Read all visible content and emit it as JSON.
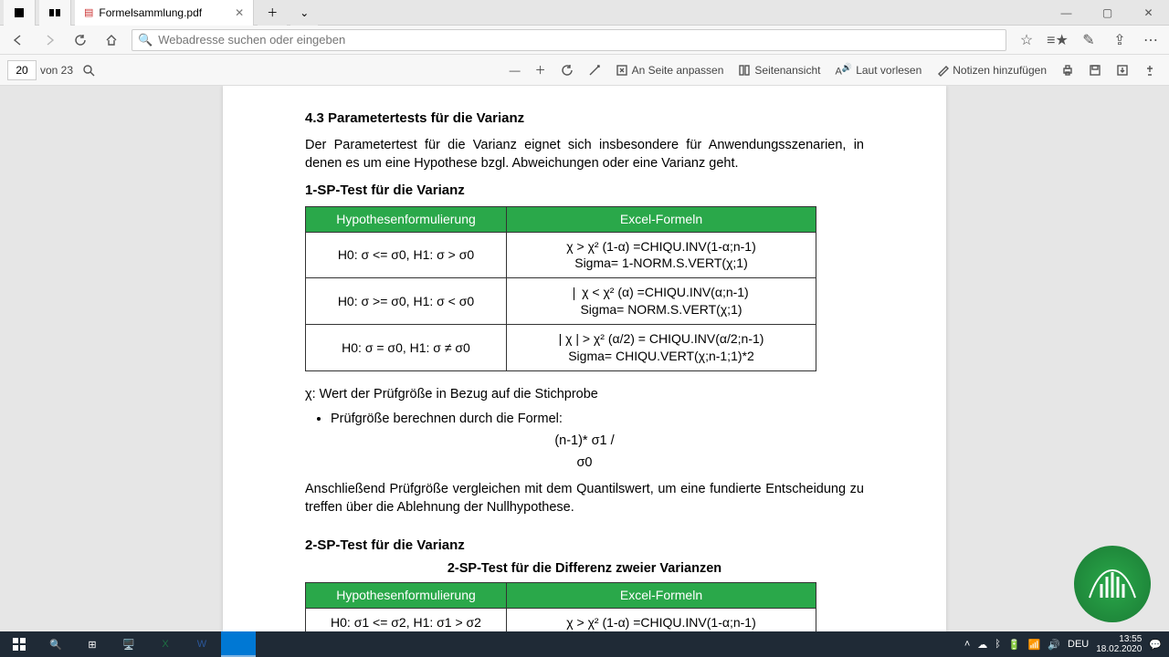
{
  "window": {
    "tab_title": "Formelsammlung.pdf",
    "minimize": "—",
    "maximize": "▢",
    "close": "✕"
  },
  "address_bar": {
    "placeholder": "Webadresse suchen oder eingeben"
  },
  "pdf_toolbar": {
    "page_current": "20",
    "page_of": "von 23",
    "fit_page": "An Seite anpassen",
    "page_view": "Seitenansicht",
    "read_aloud": "Laut vorlesen",
    "add_notes": "Notizen hinzufügen"
  },
  "doc": {
    "h43": "4.3 Parametertests für die Varianz",
    "intro": "Der Parametertest für die Varianz eignet sich insbesondere für Anwendungsszenarien, in denen es um eine Hypothese bzgl. Abweichungen oder eine Varianz geht.",
    "sp1_title": "1-SP-Test für die Varianz",
    "th1": "Hypothesenformulierung",
    "th2": "Excel-Formeln",
    "r1c1": "H0: σ <= σ0, H1: σ > σ0",
    "r1c2a": "χ > χ² (1-α) =CHIQU.INV(1-α;n-1)",
    "r1c2b": "Sigma= 1-NORM.S.VERT(χ;1)",
    "r2c1": "H0: σ >= σ0, H1: σ < σ0",
    "r2c2a": "χ < χ² (α) =CHIQU.INV(α;n-1)",
    "r2c2b": "Sigma= NORM.S.VERT(χ;1)",
    "r3c1": "H0: σ = σ0, H1: σ ≠ σ0",
    "r3c2a": "| χ | > χ² (α/2) = CHIQU.INV(α/2;n-1)",
    "r3c2b": "Sigma= CHIQU.VERT(χ;n-1;1)*2",
    "chi_note": "χ: Wert der Prüfgröße in Bezug auf die Stichprobe",
    "bullet1": "Prüfgröße berechnen durch die Formel:",
    "formula1": "(n-1)* σ1 /",
    "formula2": "σ0",
    "closing": "Anschließend Prüfgröße vergleichen mit dem Quantilswert, um eine fundierte Entscheidung zu treffen über die Ablehnung der Nullhypothese.",
    "sp2_title": "2-SP-Test für die Varianz",
    "sp2_sub": "2-SP-Test für die Differenz zweier Varianzen",
    "t2r1c1": "H0: σ1 <= σ2, H1: σ1 > σ2",
    "t2r1c2": "χ > χ² (1-α) =CHIQU.INV(1-α;n-1)"
  },
  "taskbar": {
    "lang": "DEU",
    "time": "13:55",
    "date": "18.02.2020"
  }
}
